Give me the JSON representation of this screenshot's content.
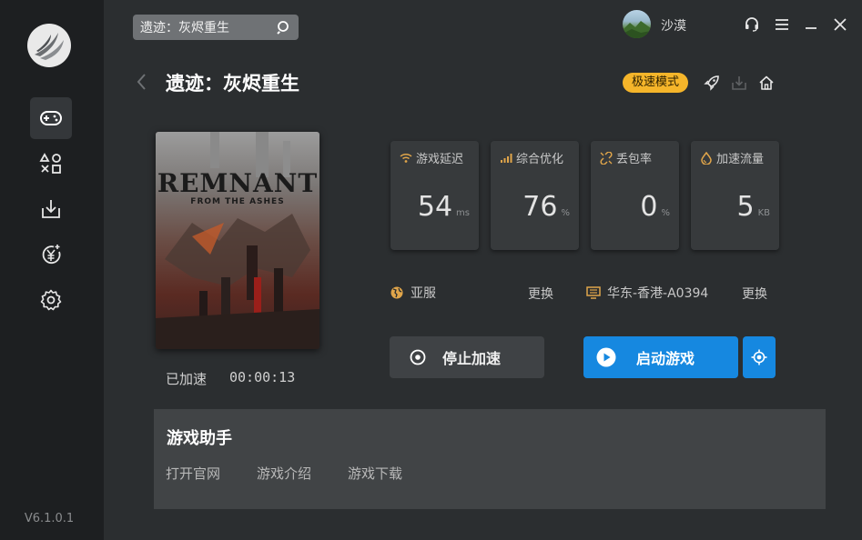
{
  "app": {
    "version": "V6.1.0.1",
    "search_value": "遗迹：灰烬重生",
    "username": "沙漠"
  },
  "page": {
    "title": "遗迹：灰烬重生",
    "speed_mode_badge": "极速模式"
  },
  "game_cover": {
    "title": "REMNANT",
    "subtitle": "FROM THE ASHES"
  },
  "status": {
    "label": "已加速",
    "elapsed": "00:00:13"
  },
  "stats": [
    {
      "label": "游戏延迟",
      "value": "54",
      "unit": "ms",
      "icon": "wifi-icon"
    },
    {
      "label": "综合优化",
      "value": "76",
      "unit": "%",
      "icon": "bars-icon"
    },
    {
      "label": "丢包率",
      "value": "0",
      "unit": "%",
      "icon": "broken-link-icon"
    },
    {
      "label": "加速流量",
      "value": "5",
      "unit": "KB",
      "icon": "drop-icon"
    }
  ],
  "region": {
    "name": "亚服",
    "change": "更换"
  },
  "node": {
    "name": "华东-香港-A0394",
    "change": "更换"
  },
  "buttons": {
    "stop": "停止加速",
    "start": "启动游戏"
  },
  "assistant": {
    "title": "游戏助手",
    "links": [
      "打开官网",
      "游戏介绍",
      "游戏下载"
    ]
  },
  "colors": {
    "accent_blue": "#1688e0",
    "badge_yellow": "#f5b52a",
    "stat_icon_orange": "#e0a54a"
  }
}
